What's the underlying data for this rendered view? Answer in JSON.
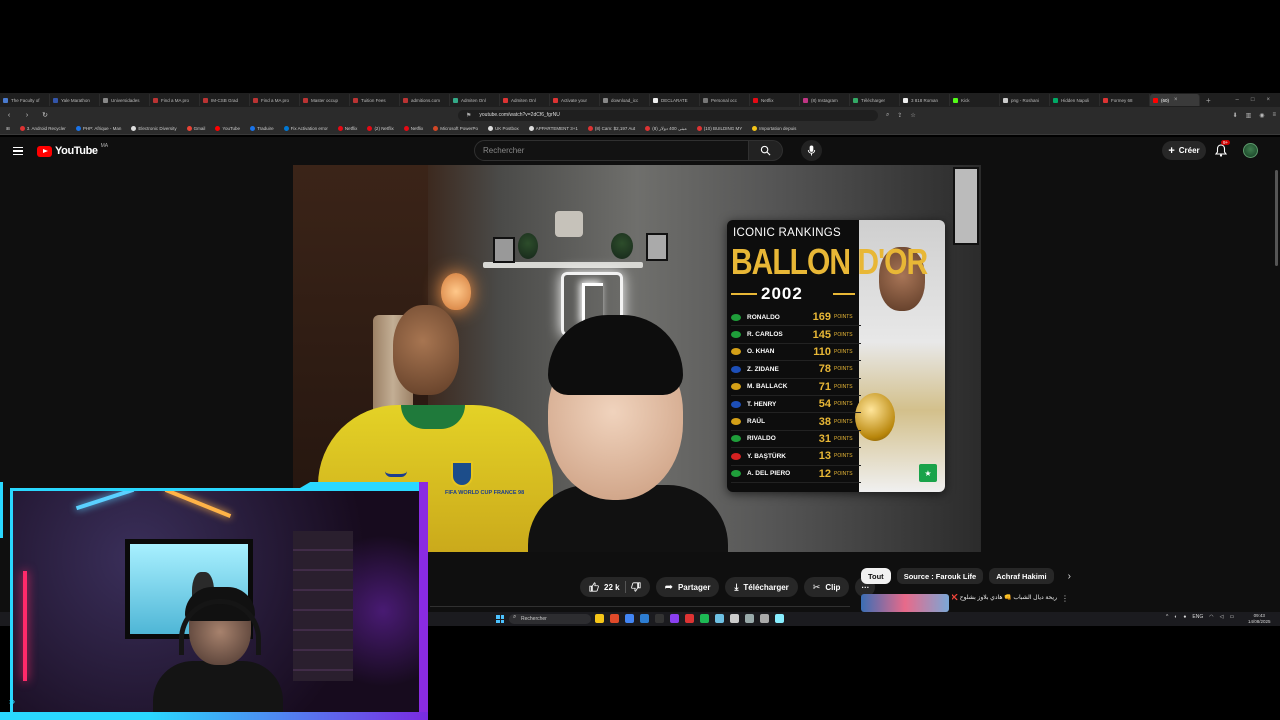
{
  "browser": {
    "tabs": [
      {
        "label": "The Faculty of",
        "color": "#4a7bd0"
      },
      {
        "label": "Yale Marathon",
        "color": "#3355aa"
      },
      {
        "label": "Universidades",
        "color": "#888888"
      },
      {
        "label": "Find a MA pro",
        "color": "#b33"
      },
      {
        "label": "IM-CSB Grad",
        "color": "#b33"
      },
      {
        "label": "Find a MA pro",
        "color": "#b33"
      },
      {
        "label": "Master occup",
        "color": "#b33"
      },
      {
        "label": "Tuition Fees",
        "color": "#b33"
      },
      {
        "label": "admitions.com",
        "color": "#b33"
      },
      {
        "label": "Admiten Onl",
        "color": "#3a8"
      },
      {
        "label": "Admiten Onl",
        "color": "#d33"
      },
      {
        "label": "Activate your",
        "color": "#d33"
      },
      {
        "label": "download_icc",
        "color": "#888"
      },
      {
        "label": "DECLARATE",
        "color": "#eee"
      },
      {
        "label": "Personal occ",
        "color": "#777"
      },
      {
        "label": "Netflix",
        "color": "#e50914"
      },
      {
        "label": "(8) Instagram",
        "color": "#c13584"
      },
      {
        "label": "Télécharger",
        "color": "#3a6"
      },
      {
        "label": "3 818 Roman",
        "color": "#eee"
      },
      {
        "label": "Kick",
        "color": "#53fc18"
      },
      {
        "label": "png - Roshani",
        "color": "#ccc"
      },
      {
        "label": "Hidden Napoli",
        "color": "#0a6"
      },
      {
        "label": "Formey 68",
        "color": "#d33"
      },
      {
        "label": "(60)",
        "color": "#f00"
      }
    ],
    "url": "youtube.com/watch?v=2dCf6_fgrNU",
    "bookmarks": [
      {
        "label": "3. Android Recycler",
        "color": "#d33"
      },
      {
        "label": "PHP: Afrique - Man",
        "color": "#1a73e8"
      },
      {
        "label": "Electronic Diversity",
        "color": "#ddd"
      },
      {
        "label": "Gmail",
        "color": "#ea4335"
      },
      {
        "label": "YouTube",
        "color": "#ff0000"
      },
      {
        "label": "Traduire",
        "color": "#1a73e8"
      },
      {
        "label": "Fix Activation error",
        "color": "#0078d4"
      },
      {
        "label": "Netflix",
        "color": "#e50914"
      },
      {
        "label": "(2) Netflix",
        "color": "#e50914"
      },
      {
        "label": "Netflix",
        "color": "#e50914"
      },
      {
        "label": "Microsoft PowerPo",
        "color": "#d24726"
      },
      {
        "label": "UK Postbox",
        "color": "#ddd"
      },
      {
        "label": "APPARTEMENT 3+1",
        "color": "#ddd"
      },
      {
        "label": "(8) Cam: $2,197 Aut",
        "color": "#d33"
      },
      {
        "label": "مبنى 400 دولار (8)",
        "color": "#d33"
      },
      {
        "label": "(10) BUILDING MY",
        "color": "#d33"
      },
      {
        "label": "Importation depuis",
        "color": "#f5c518"
      }
    ]
  },
  "youtube": {
    "logo_text": "YouTube",
    "region": "MA",
    "search_placeholder": "Rechercher",
    "create_label": "Créer",
    "notif_count": "9+"
  },
  "video": {
    "card": {
      "top": "ICONIC RANKINGS",
      "title": "BALLON D'OR",
      "year": "2002",
      "unit": "POINTS",
      "rows": [
        {
          "name": "RONALDO",
          "points": "169",
          "flag": "#1f9e3a"
        },
        {
          "name": "R. CARLOS",
          "points": "145",
          "flag": "#1f9e3a"
        },
        {
          "name": "O. KHAN",
          "points": "110",
          "flag": "#d4a017"
        },
        {
          "name": "Z. ZIDANE",
          "points": "78",
          "flag": "#1d4fb8"
        },
        {
          "name": "M. BALLACK",
          "points": "71",
          "flag": "#d4a017"
        },
        {
          "name": "T. HENRY",
          "points": "54",
          "flag": "#1d4fb8"
        },
        {
          "name": "RAÚL",
          "points": "38",
          "flag": "#d4a017"
        },
        {
          "name": "RIVALDO",
          "points": "31",
          "flag": "#1f9e3a"
        },
        {
          "name": "Y. BAŞTÜRK",
          "points": "13",
          "flag": "#d42121"
        },
        {
          "name": "A. DEL PIERO",
          "points": "12",
          "flag": "#1f9e3a"
        }
      ]
    },
    "jersey_text": "FIFA WORLD CUP FRANCE 98"
  },
  "actions": {
    "likes": "22 k",
    "share": "Partager",
    "download": "Télécharger",
    "clip": "Clip"
  },
  "chips": [
    "Tout",
    "Source : Farouk Life",
    "Achraf Hakimi"
  ],
  "reco": {
    "title": "ريحة ديال الشباب 👊 هادي بلاوز بشلوح ❌"
  },
  "taskbar": {
    "search": "Rechercher",
    "lang": "ENG",
    "time": "09:43",
    "date": "14/08/2025"
  }
}
